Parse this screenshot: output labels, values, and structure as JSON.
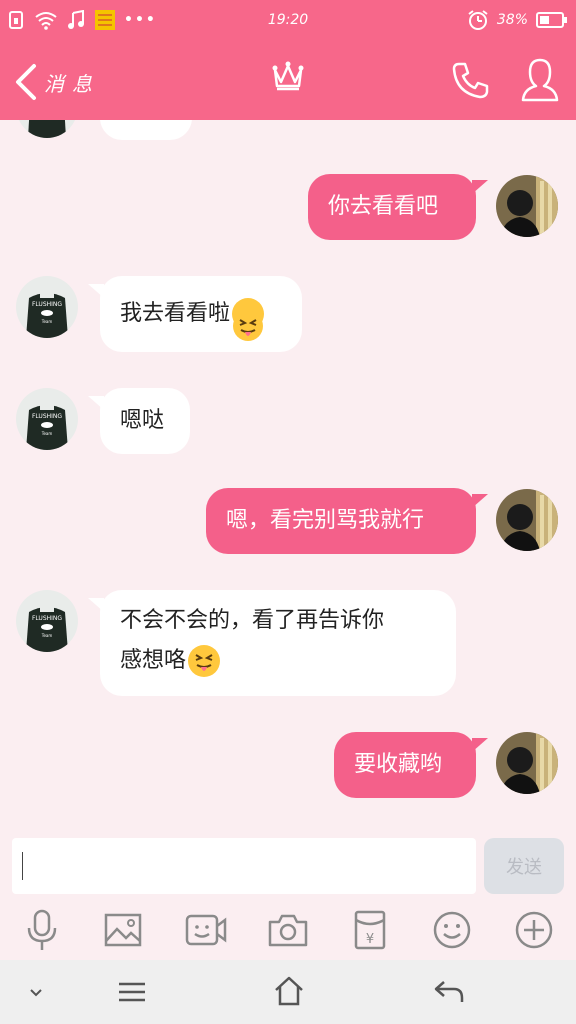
{
  "status_bar": {
    "time": "19:20",
    "battery": "38%"
  },
  "nav": {
    "back_label": "消息",
    "icons": [
      "crown-icon",
      "phone-icon",
      "profile-icon"
    ]
  },
  "messages": [
    {
      "side": "in",
      "text": ""
    },
    {
      "side": "out",
      "text": "你去看看吧"
    },
    {
      "side": "in",
      "text": "我去看看啦"
    },
    {
      "side": "in",
      "text": "嗯哒"
    },
    {
      "side": "out",
      "text": "嗯，看完别骂我就行"
    },
    {
      "side": "in",
      "text": "不会不会的，看了再告诉你",
      "text2": "感想咯"
    },
    {
      "side": "out",
      "text": "要收藏哟"
    }
  ],
  "input": {
    "value": "",
    "send_label": "发送"
  },
  "toolbar": [
    "mic-icon",
    "image-icon",
    "video-icon",
    "camera-icon",
    "red-packet-icon",
    "emoji-icon",
    "plus-icon"
  ],
  "colors": {
    "accent": "#f7678a",
    "bubble_out": "#f4608a",
    "background": "#fbeef1"
  }
}
